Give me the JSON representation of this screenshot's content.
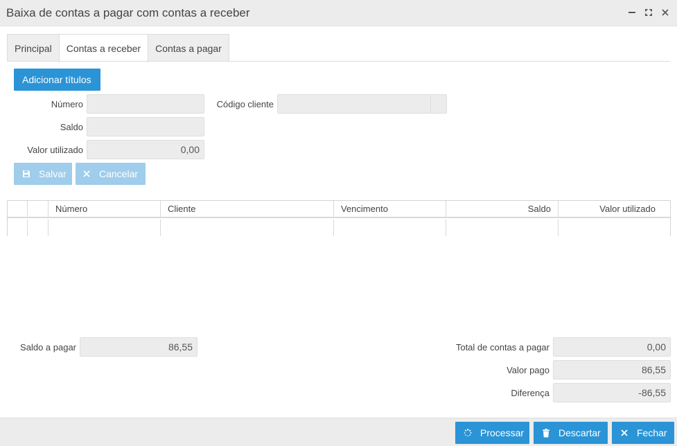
{
  "window": {
    "title": "Baixa de contas a pagar com contas a receber"
  },
  "tabs": [
    {
      "label": "Principal"
    },
    {
      "label": "Contas a receber"
    },
    {
      "label": "Contas a pagar"
    }
  ],
  "active_tab": "Contas a receber",
  "form": {
    "add_button": "Adicionar títulos",
    "numero_label": "Número",
    "numero_value": "",
    "codigo_cliente_label": "Código cliente",
    "codigo_cliente_value": "",
    "saldo_label": "Saldo",
    "saldo_value": "",
    "valor_utilizado_label": "Valor utilizado",
    "valor_utilizado_value": "0,00",
    "save_button": "Salvar",
    "cancel_button": "Cancelar"
  },
  "grid": {
    "columns": [
      "",
      "",
      "Número",
      "Cliente",
      "Vencimento",
      "Saldo",
      "Valor utilizado"
    ],
    "rows": []
  },
  "summary": {
    "saldo_a_pagar_label": "Saldo a pagar",
    "saldo_a_pagar_value": "86,55",
    "total_contas_label": "Total de contas a pagar",
    "total_contas_value": "0,00",
    "valor_pago_label": "Valor pago",
    "valor_pago_value": "86,55",
    "diferenca_label": "Diferença",
    "diferenca_value": "-86,55"
  },
  "footer": {
    "process_button": "Processar",
    "discard_button": "Descartar",
    "close_button": "Fechar"
  },
  "colors": {
    "primary": "#2a94d6",
    "primary_disabled": "#9fcdeb",
    "field_bg": "#ececec",
    "titlebar_bg": "#ececec"
  },
  "icons": {
    "minimize": "minimize-icon",
    "maximize": "maximize-icon",
    "close": "close-icon",
    "save": "save-icon",
    "cancel": "x-icon",
    "process": "spinner-icon",
    "discard": "trash-icon",
    "close_footer": "x-icon"
  }
}
